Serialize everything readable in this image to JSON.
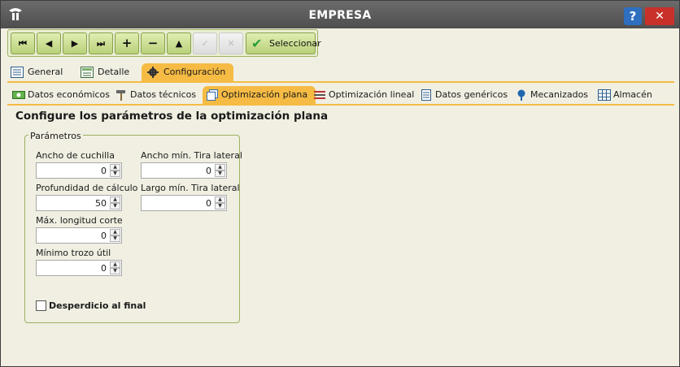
{
  "window": {
    "title": "EMPRESA",
    "logo_icon": "app-logo-icon",
    "help_label": "?",
    "close_label": "✕"
  },
  "toolbar": {
    "first": "⏮",
    "prev": "◀",
    "next": "▶",
    "last": "⏭",
    "add": "+",
    "remove": "−",
    "up": "▲",
    "confirm": "✓",
    "cancel": "✕",
    "select_label": "Seleccionar"
  },
  "tabs_primary": [
    {
      "label": "General",
      "icon": "list-icon"
    },
    {
      "label": "Detalle",
      "icon": "detail-icon"
    },
    {
      "label": "Configuración",
      "icon": "gear-icon",
      "active": true
    }
  ],
  "tabs_secondary": [
    {
      "label": "Datos económicos",
      "icon": "money-icon"
    },
    {
      "label": "Datos técnicos",
      "icon": "hammer-icon"
    },
    {
      "label": "Optimización plana",
      "icon": "pages-icon",
      "active": true
    },
    {
      "label": "Optimización lineal",
      "icon": "lines-icon"
    },
    {
      "label": "Datos genéricos",
      "icon": "document-icon"
    },
    {
      "label": "Mecanizados",
      "icon": "pin-icon"
    },
    {
      "label": "Almacén",
      "icon": "grid-icon"
    }
  ],
  "main": {
    "heading": "Configure los parámetros de la optimización plana",
    "group_title": "Parámetros",
    "fields": {
      "ancho_cuchilla": {
        "label": "Ancho de cuchilla",
        "value": "0"
      },
      "profundidad_calculo": {
        "label": "Profundidad de cálculo",
        "value": "50"
      },
      "max_longitud_corte": {
        "label": "Máx. longitud corte",
        "value": "0"
      },
      "minimo_trozo_util": {
        "label": "Mínimo trozo útil",
        "value": "0"
      },
      "ancho_min_tira": {
        "label": "Ancho mín. Tira lateral",
        "value": "0"
      },
      "largo_min_tira": {
        "label": "Largo mín. Tira lateral",
        "value": "0"
      }
    },
    "checkbox": {
      "label": "Desperdicio al final",
      "checked": false
    }
  },
  "colors": {
    "tab_active": "#f6bb44",
    "toolbar_green": "#b9d179",
    "titlebar": "#5a5a5a",
    "close": "#c8312a",
    "help": "#2e6fbf"
  }
}
